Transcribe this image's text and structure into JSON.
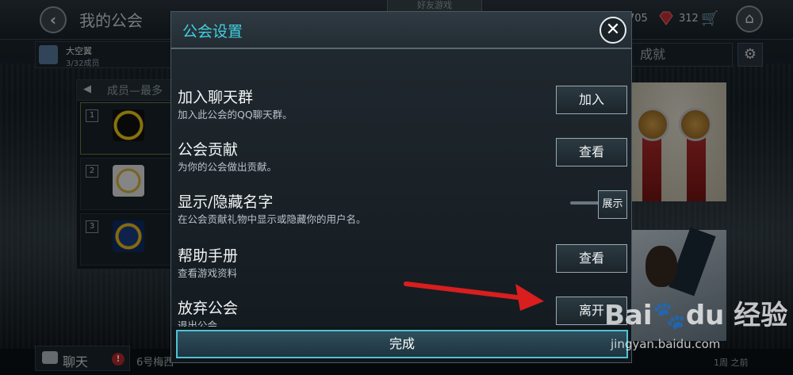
{
  "background": {
    "page_title": "我的公会",
    "top_tab": "好友游戏",
    "resource_count": "705",
    "gem_count": "312",
    "club": {
      "name": "大空翼",
      "members": "3/32成员"
    },
    "achievements_tab": "成就",
    "members_header": "成员—最多",
    "member_ranks": [
      "1",
      "2",
      "3"
    ],
    "chat_label": "聊天",
    "chat_badge": "!",
    "chat_preview": "6号梅西",
    "time_label": "1周 之前"
  },
  "modal": {
    "title": "公会设置",
    "rows": [
      {
        "title": "加入聊天群",
        "desc": "加入此公会的QQ聊天群。",
        "button": "加入"
      },
      {
        "title": "公会贡献",
        "desc": "为你的公会做出贡献。",
        "button": "查看"
      },
      {
        "title": "显示/隐藏名字",
        "desc": "在公会贡献礼物中显示或隐藏你的用户名。",
        "button": "展示"
      },
      {
        "title": "帮助手册",
        "desc": "查看游戏资料",
        "button": "查看"
      },
      {
        "title": "放弃公会",
        "desc": "退出公会。",
        "button": "离开"
      }
    ],
    "done_button": "完成"
  },
  "annotation": {
    "arrow_color": "#d81e1e"
  },
  "watermark": {
    "logo": "Bai du 经验",
    "url": "jingyan.baidu.com"
  },
  "colors": {
    "accent": "#3fd1e0",
    "done_border": "#4fc3d2"
  }
}
